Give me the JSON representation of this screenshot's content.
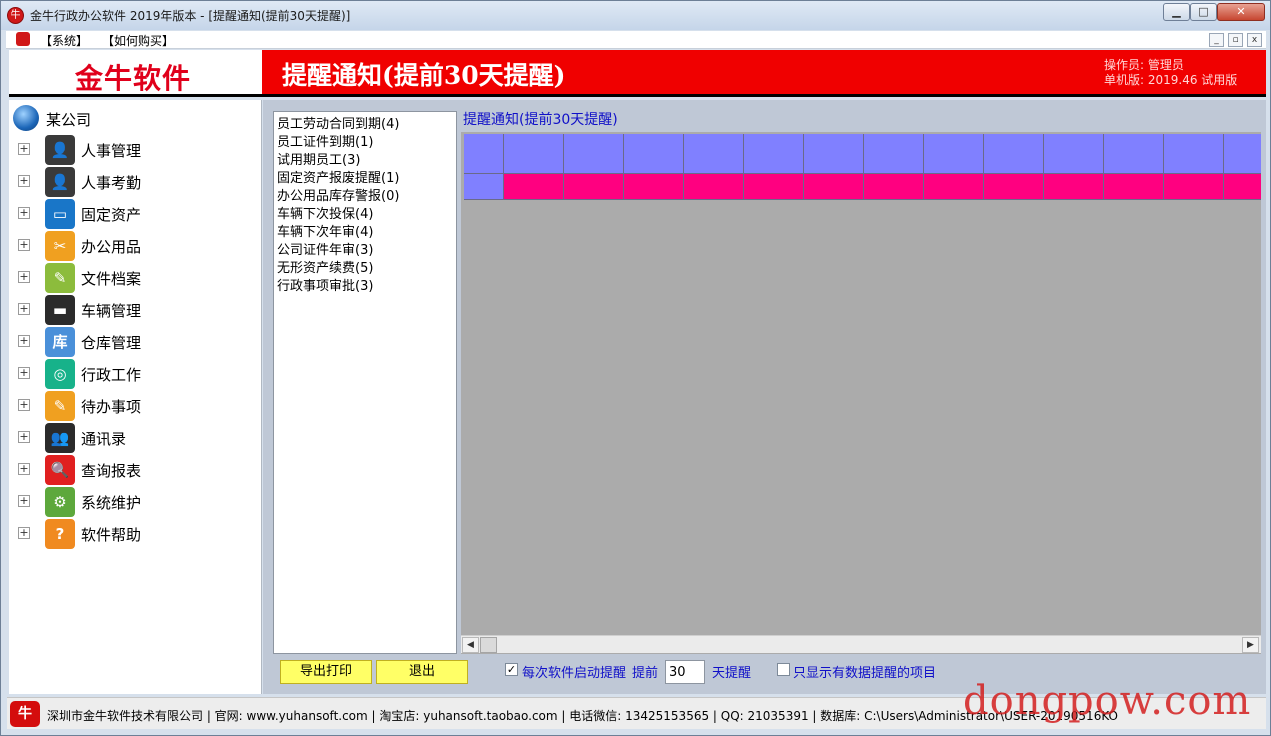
{
  "window": {
    "title": "金牛行政办公软件 2019年版本 - [提醒通知(提前30天提醒)]",
    "minimize_glyph": "▁",
    "maximize_glyph": "□",
    "close_glyph": "✕"
  },
  "menu": {
    "items": [
      "【系统】",
      "【如何购买】"
    ],
    "mdi_glyphs": [
      "_",
      "▫",
      "x"
    ]
  },
  "logo": {
    "text": "金牛软件"
  },
  "header": {
    "title": "提醒通知(提前30天提醒)",
    "operator": "操作员: 管理员",
    "version": "单机版: 2019.46 试用版"
  },
  "sidebar": {
    "company": "某公司",
    "expander_glyph": "+",
    "items": [
      {
        "label": "人事管理",
        "icon": "person-icon",
        "glyph": "👤",
        "color": "#3a3a3a"
      },
      {
        "label": "人事考勤",
        "icon": "person-clock-icon",
        "glyph": "👤",
        "color": "#3a3a3a"
      },
      {
        "label": "固定资产",
        "icon": "computer-icon",
        "glyph": "▭",
        "color": "#1976c8"
      },
      {
        "label": "办公用品",
        "icon": "scissors-icon",
        "glyph": "✂",
        "color": "#f0a020"
      },
      {
        "label": "文件档案",
        "icon": "notebook-icon",
        "glyph": "✎",
        "color": "#8cbc3c"
      },
      {
        "label": "车辆管理",
        "icon": "car-icon",
        "glyph": "▬",
        "color": "#2b2b2b"
      },
      {
        "label": "仓库管理",
        "icon": "warehouse-icon",
        "glyph": "库",
        "color": "#4a90d9"
      },
      {
        "label": "行政工作",
        "icon": "search-circle-icon",
        "glyph": "◎",
        "color": "#17b28a"
      },
      {
        "label": "待办事项",
        "icon": "todo-notebook-icon",
        "glyph": "✎",
        "color": "#f0a020"
      },
      {
        "label": "通讯录",
        "icon": "contacts-icon",
        "glyph": "👥",
        "color": "#2b2b2b"
      },
      {
        "label": "查询报表",
        "icon": "magnifier-icon",
        "glyph": "🔍",
        "color": "#e02020"
      },
      {
        "label": "系统维护",
        "icon": "gear-icon",
        "glyph": "⚙",
        "color": "#5da83c"
      },
      {
        "label": "软件帮助",
        "icon": "help-icon",
        "glyph": "?",
        "color": "#f08a20"
      }
    ]
  },
  "reminders": {
    "items": [
      "员工劳动合同到期(4)",
      "员工证件到期(1)",
      "试用期员工(3)",
      "固定资产报废提醒(1)",
      "办公用品库存警报(0)",
      "车辆下次投保(4)",
      "车辆下次年审(4)",
      "公司证件年审(3)",
      "无形资产续费(5)",
      "行政事项审批(3)"
    ]
  },
  "grid": {
    "caption": "提醒通知(提前30天提醒)",
    "header_color": "#8080ff",
    "row_color": "#ff0080",
    "scroll_left_glyph": "◀",
    "scroll_right_glyph": "▶"
  },
  "actions": {
    "export_label": "导出打印",
    "exit_label": "退出"
  },
  "options": {
    "startup_checked": true,
    "check_glyph": "✓",
    "startup_label": "每次软件启动提醒",
    "advance_label": "提前",
    "days_value": "30",
    "days_suffix": "天提醒",
    "only_data_checked": false,
    "only_data_label": "只显示有数据提醒的项目"
  },
  "status": {
    "logo_glyph": "牛",
    "text": "深圳市金牛软件技术有限公司 | 官网: www.yuhansoft.com | 淘宝店: yuhansoft.taobao.com | 电话微信: 13425153565 | QQ: 21035391 | 数据库: C:\\Users\\Administrator\\USER-20190516KO"
  },
  "watermark": "dongpow.com"
}
